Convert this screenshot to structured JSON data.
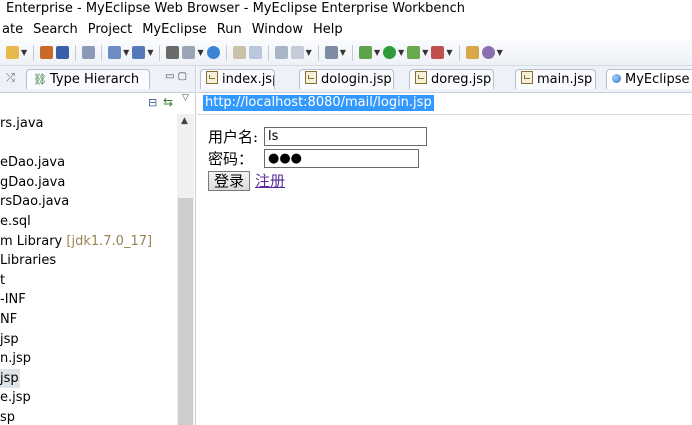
{
  "window": {
    "title": "Enterprise - MyEclipse Web Browser - MyEclipse Enterprise Workbench"
  },
  "menu": [
    "ate",
    "Search",
    "Project",
    "MyEclipse",
    "Run",
    "Window",
    "Help"
  ],
  "toolbar": {
    "icons": [
      "new-icon",
      "package-icon",
      "server-icon",
      "deploy-icon",
      "run-icon",
      "debug-icon",
      "build-icon",
      "search-icon"
    ]
  },
  "left_panel": {
    "tab_label": "Type Hierarch",
    "tree": [
      {
        "text": "rs.java"
      },
      {
        "text": ""
      },
      {
        "text": "eDao.java"
      },
      {
        "text": "gDao.java"
      },
      {
        "text": "rsDao.java"
      },
      {
        "text": "e.sql"
      },
      {
        "text": "m Library",
        "suffix": "[jdk1.7.0_17]"
      },
      {
        "text": "Libraries"
      },
      {
        "text": "t"
      },
      {
        "text": "-INF"
      },
      {
        "text": "NF"
      },
      {
        "text": "jsp"
      },
      {
        "text": "n.jsp"
      },
      {
        "text": "jsp",
        "selected": true
      },
      {
        "text": "e.jsp"
      },
      {
        "text": "sp"
      }
    ]
  },
  "editor_tabs": [
    {
      "label": "index.jsp",
      "type": "jsp"
    },
    {
      "label": "dologin.jsp",
      "type": "jsp"
    },
    {
      "label": "doreg.jsp",
      "type": "jsp"
    },
    {
      "label": "main.jsp",
      "type": "jsp"
    },
    {
      "label": "MyEclipse",
      "type": "browser",
      "active": true
    }
  ],
  "browser": {
    "url": "http://localhost:8080/mail/login.jsp",
    "username_label": "用户名:",
    "username_value": "ls",
    "password_label": "密码：",
    "password_value": "●●●",
    "login_button": "登录",
    "register_link": "注册"
  }
}
